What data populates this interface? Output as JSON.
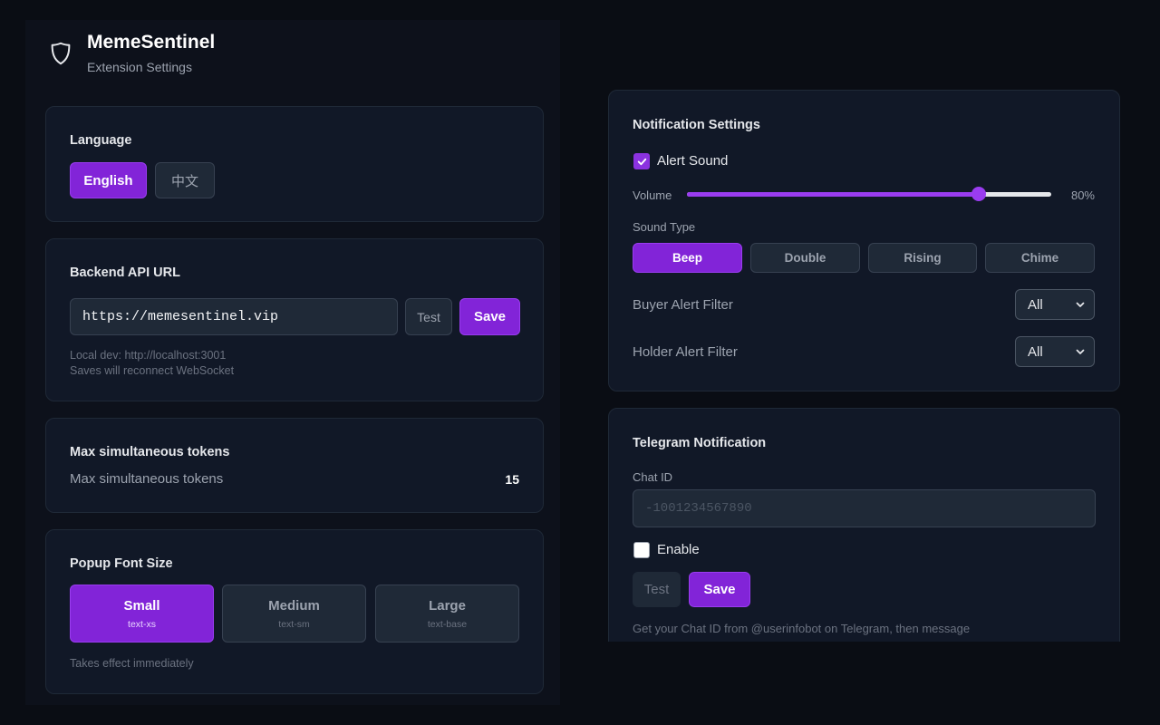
{
  "header": {
    "title": "MemeSentinel",
    "subtitle": "Extension Settings"
  },
  "language": {
    "title": "Language",
    "options": [
      "English",
      "中文"
    ],
    "selected": "English"
  },
  "backend": {
    "title": "Backend API URL",
    "url_value": "https://memesentinel.vip",
    "test_label": "Test",
    "save_label": "Save",
    "hint_line1": "Local dev: http://localhost:3001",
    "hint_line2": "Saves will reconnect WebSocket"
  },
  "max_tokens": {
    "title": "Max simultaneous tokens",
    "label": "Max simultaneous tokens",
    "value": "15"
  },
  "font_size": {
    "title": "Popup Font Size",
    "options": [
      {
        "label": "Small",
        "sub": "text-xs"
      },
      {
        "label": "Medium",
        "sub": "text-sm"
      },
      {
        "label": "Large",
        "sub": "text-base"
      }
    ],
    "selected": "Small",
    "hint": "Takes effect immediately"
  },
  "notification": {
    "title": "Notification Settings",
    "alert_sound_label": "Alert Sound",
    "alert_sound_checked": true,
    "volume_label": "Volume",
    "volume_value": "80%",
    "volume_fraction": 0.8,
    "sound_type_label": "Sound Type",
    "sound_types": [
      "Beep",
      "Double",
      "Rising",
      "Chime"
    ],
    "sound_type_selected": "Beep",
    "buyer_filter_label": "Buyer Alert Filter",
    "buyer_filter_value": "All",
    "holder_filter_label": "Holder Alert Filter",
    "holder_filter_value": "All"
  },
  "telegram": {
    "title": "Telegram Notification",
    "chat_id_label": "Chat ID",
    "chat_id_placeholder": "-1001234567890",
    "enable_label": "Enable",
    "enable_checked": false,
    "test_label": "Test",
    "save_label": "Save",
    "hint": "Get your Chat ID from @userinfobot on Telegram, then message"
  },
  "colors": {
    "accent": "#8224d8",
    "background": "#0a0d14",
    "card": "#111827"
  }
}
